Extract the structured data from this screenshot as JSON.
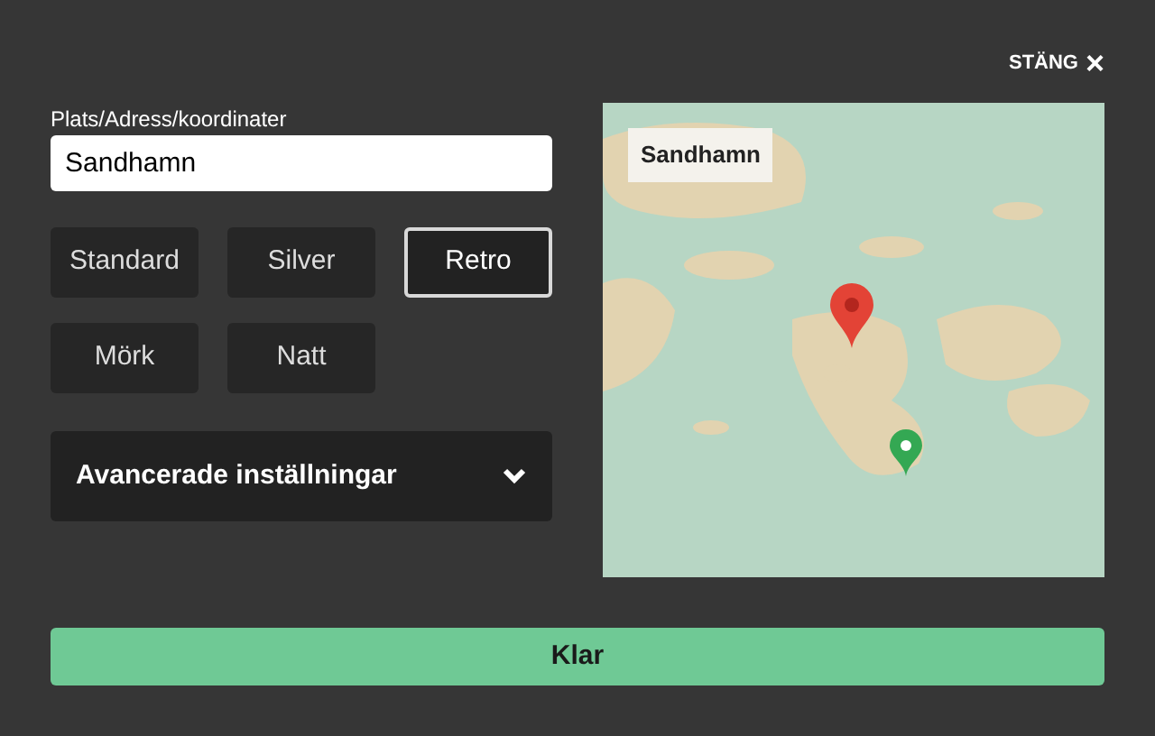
{
  "close_button": {
    "label": "STÄNG",
    "icon": "×"
  },
  "location": {
    "label": "Plats/Adress/koordinater",
    "value": "Sandhamn"
  },
  "styles": [
    {
      "label": "Standard",
      "selected": false
    },
    {
      "label": "Silver",
      "selected": false
    },
    {
      "label": "Retro",
      "selected": true
    },
    {
      "label": "Mörk",
      "selected": false
    },
    {
      "label": "Natt",
      "selected": false
    }
  ],
  "advanced": {
    "label": "Avancerade inställningar",
    "expanded": false
  },
  "map": {
    "label": "Sandhamn"
  },
  "done_button": {
    "label": "Klar"
  }
}
